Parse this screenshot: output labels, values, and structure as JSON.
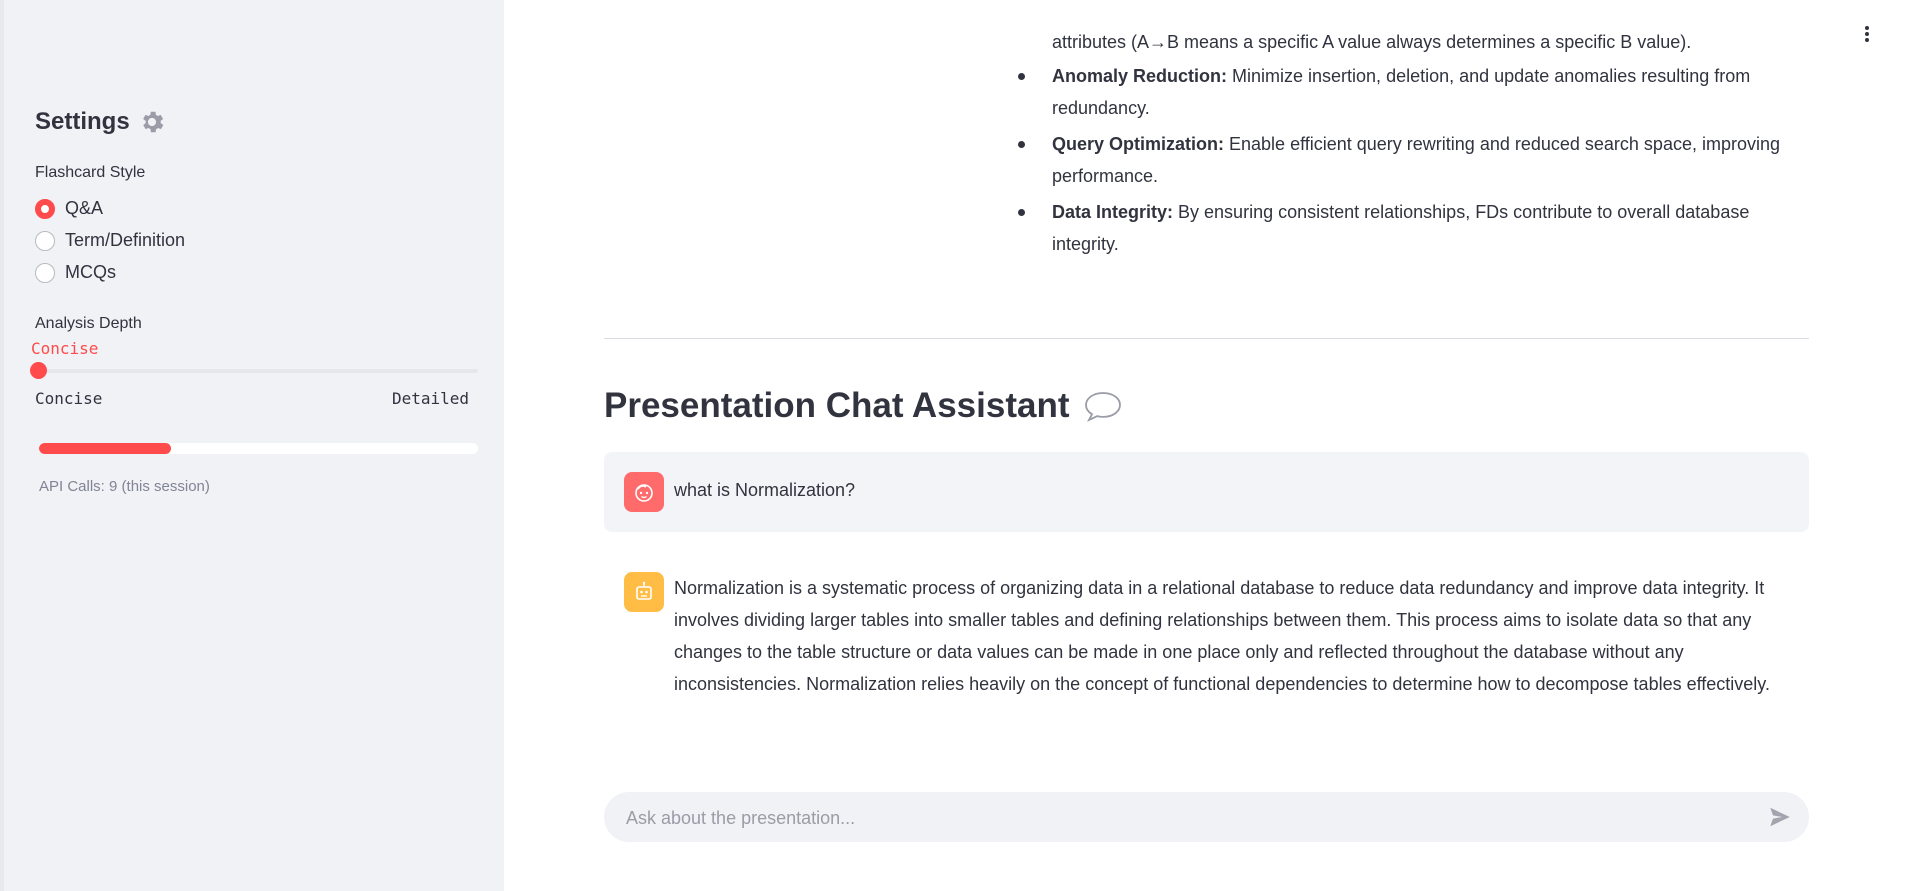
{
  "sidebar": {
    "title": "Settings",
    "flashcard_style": {
      "label": "Flashcard Style",
      "options": [
        "Q&A",
        "Term/Definition",
        "MCQs"
      ],
      "selected": "Q&A"
    },
    "analysis_depth": {
      "label": "Analysis Depth",
      "value": "Concise",
      "min_label": "Concise",
      "max_label": "Detailed"
    },
    "usage_progress": 0.3,
    "api_calls": "API Calls: 9 (this session)"
  },
  "main": {
    "partial_bullet": "attributes (A→B means a specific A value always determines a specific B value).",
    "bullets": [
      {
        "term": "Anomaly Reduction:",
        "text": " Minimize insertion, deletion, and update anomalies resulting from redundancy."
      },
      {
        "term": "Query Optimization:",
        "text": " Enable efficient query rewriting and reduced search space, improving performance."
      },
      {
        "term": "Data Integrity:",
        "text": " By ensuring consistent relationships, FDs contribute to overall database integrity."
      }
    ],
    "chat": {
      "title": "Presentation Chat Assistant",
      "messages": [
        {
          "role": "user",
          "text": "what is Normalization?"
        },
        {
          "role": "assistant",
          "text": "Normalization is a systematic process of organizing data in a relational database to reduce data redundancy and improve data integrity. It involves dividing larger tables into smaller tables and defining relationships between them. This process aims to isolate data so that any changes to the table structure or data values can be made in one place only and reflected throughout the database without any inconsistencies. Normalization relies heavily on the concept of functional dependencies to determine how to decompose tables effectively."
        }
      ],
      "input_placeholder": "Ask about the presentation..."
    }
  },
  "colors": {
    "accent": "#ff4b4b",
    "sidebar_bg": "#f0f2f6",
    "user_avatar": "#ff6b6b",
    "bot_avatar": "#ffbd45"
  }
}
